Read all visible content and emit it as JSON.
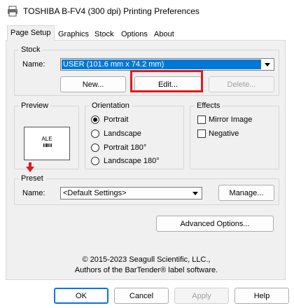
{
  "window": {
    "title": "TOSHIBA B-FV4 (300 dpi) Printing Preferences",
    "icon": "printer-app-icon"
  },
  "tabs": [
    "Page Setup",
    "Graphics",
    "Stock",
    "Options",
    "About"
  ],
  "active_tab": "Page Setup",
  "stock": {
    "group_label": "Stock",
    "name_label": "Name:",
    "name_value": "USER (101.6 mm x 74.2 mm)",
    "new_button": "New...",
    "edit_button": "Edit...",
    "delete_button": "Delete..."
  },
  "preview": {
    "group_label": "Preview",
    "sample_text": "ALE",
    "arrow_color": "#e0191f"
  },
  "orientation": {
    "group_label": "Orientation",
    "options": [
      "Portrait",
      "Landscape",
      "Portrait 180°",
      "Landscape 180°"
    ],
    "selected": "Portrait"
  },
  "effects": {
    "group_label": "Effects",
    "mirror_image": "Mirror Image",
    "negative": "Negative",
    "mirror_checked": false,
    "negative_checked": false
  },
  "preset": {
    "group_label": "Preset",
    "name_label": "Name:",
    "name_value": "<Default Settings>",
    "manage_button": "Manage..."
  },
  "advanced_button": "Advanced Options...",
  "footer": {
    "copyright": "© 2015-2023 Seagull Scientific, LLC.,",
    "authors": "Authors of the BarTender® label software."
  },
  "buttons": {
    "ok": "OK",
    "cancel": "Cancel",
    "apply": "Apply",
    "help": "Help"
  },
  "colors": {
    "highlight": "#e0191f",
    "selection": "#0078d7"
  }
}
